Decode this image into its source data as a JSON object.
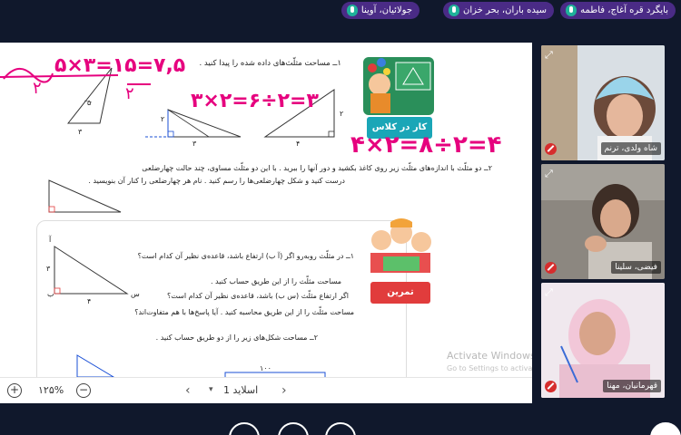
{
  "participants_bar": [
    {
      "name": "بایگرد قره آغاج، فاطمه"
    },
    {
      "name": "سیده باران، بحر خزان"
    },
    {
      "name": "جولائیان، آوینا"
    }
  ],
  "slide": {
    "q1": "۱ــ مساحت مثلّث‌های داده شده را پیدا کنید .",
    "q2_line1": "۲ــ دو مثلّث با اندازه‌های مثلّث زیر روی کاغذ بکشید و دور آنها را ببرید . با این دو مثلّث مساوی، چند حالت چهارضلعی",
    "q2_line2": "درست کنید و شکل چهارضلعی‌ها را رسم کنید . نام هر چهارضلعی را کنار آن بنویسید .",
    "badge_classwork": "کار در کلاس",
    "badge_exercise": "تمرین",
    "ex_l1": "۱ــ در مثلّث روبه‌رو اگر (آ ب) ارتفاع باشد، قاعده‌ی نظیر آن کدام است؟",
    "ex_l2": "مساحت مثلّث را از این طریق حساب کنید .",
    "ex_l3": "اگر ارتفاع مثلّث (س ب) باشد، قاعده‌ی نظیر آن کدام است؟",
    "ex_l4": "مساحت مثلّث را از این طریق محاسبه کنید . آیا پاسخ‌ها با هم متفاوت‌اند؟",
    "ex_q2": "۲ــ مساحت شکل‌های زیر را از دو طریق حساب کنید .",
    "labels": {
      "t1_side": "۵",
      "t1_base": "۳",
      "t2_h": "۲",
      "t2_b": "۳",
      "t3_h": "۲",
      "t3_b": "۴",
      "ex_a": "آ",
      "ex_b": "ب",
      "ex_s": "س",
      "ex_3": "۳",
      "ex_4": "۴",
      "fig_100": "۱۰۰"
    },
    "handwriting": {
      "h1": "۵×۳=۱۵=۷,۵",
      "h1_den": "۲",
      "h1_den2": "۲",
      "h2": "۳×۲=۶÷۲=۳",
      "h3": "۴×۲=۸÷۲=۴"
    }
  },
  "watermark": {
    "title": "Activate Windows",
    "subtitle": "Go to Settings to activate Windows."
  },
  "bottombar": {
    "zoom": "۱۲۵%",
    "slide_label": "اسلاید 1",
    "plus": "+",
    "minus": "−"
  },
  "videos": [
    {
      "name": "شاه ولدی، ترنم"
    },
    {
      "name": "فیضی، سلینا"
    },
    {
      "name": "قهرمانیان، مهنا"
    }
  ],
  "colors": {
    "pill": "#4a2b86",
    "ink": "#e6007e",
    "teal": "#1fb19a",
    "badge_red": "#e13c3c",
    "badge_teal": "#1aa6b7"
  }
}
